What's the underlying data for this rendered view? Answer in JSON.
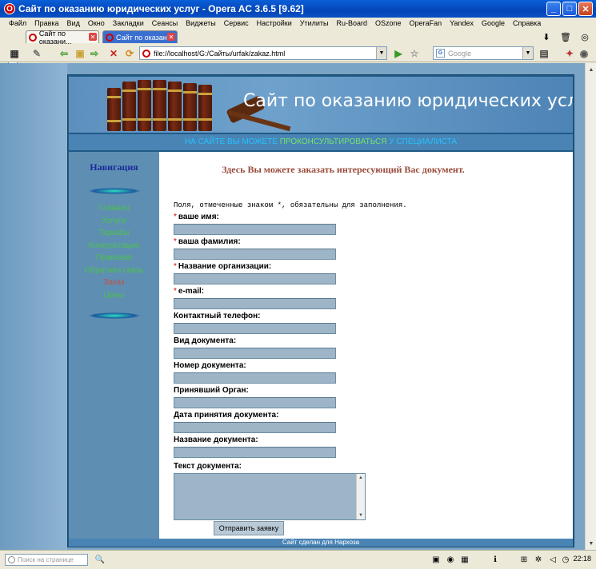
{
  "window": {
    "title": "Сайт по оказанию юридических услуг - Opera AC 3.6.5 [9.62]",
    "controls": [
      "_",
      "□",
      "✕"
    ]
  },
  "menu": [
    "Файл",
    "Правка",
    "Вид",
    "Окно",
    "Закладки",
    "Сеансы",
    "Виджеты",
    "Сервис",
    "Настройки",
    "Утилиты",
    "Ru-Board",
    "OSzone",
    "OperaFan",
    "Yandex",
    "Google",
    "Справка"
  ],
  "tabs": [
    {
      "label": "Сайт по оказани..."
    },
    {
      "label": "Сайт по оказан..."
    }
  ],
  "address": {
    "url": "file://localhost/G:/Сайты/urfak/zakaz.html"
  },
  "search": {
    "engine_initial": "G",
    "placeholder": "Google"
  },
  "site": {
    "banner_title": "Сайт по оказанию юридических услуг",
    "slogan_start": "НА САЙТЕ ВЫ МОЖЕТЕ ",
    "slogan_highlight": "ПРОКОНСУЛЬТИРОВАТЬСЯ",
    "slogan_end": " У СПЕЦИАЛИСТА",
    "sidebar": {
      "heading": "Навигация",
      "links": [
        {
          "label": "Главная",
          "active": false
        },
        {
          "label": "Услуги",
          "active": false
        },
        {
          "label": "Тарифы",
          "active": false
        },
        {
          "label": "Консультации",
          "active": false
        },
        {
          "label": "Правовая",
          "active": false
        },
        {
          "label": "Обратная связь",
          "active": false
        },
        {
          "label": "Заказ",
          "active": true
        },
        {
          "label": "Цены",
          "active": false
        }
      ]
    },
    "content": {
      "heading": "Здесь Вы можете заказать интересующий Вас документ.",
      "note": "Поля, отмеченные знаком *, обязательны для заполнения.",
      "fields": [
        {
          "label": "ваше имя:",
          "required": true,
          "value": ""
        },
        {
          "label": "ваша фамилия:",
          "required": true,
          "value": ""
        },
        {
          "label": "Название организации:",
          "required": true,
          "value": ""
        },
        {
          "label": "e-mail:",
          "required": true,
          "value": ""
        },
        {
          "label": "Контактный телефон:",
          "required": false,
          "value": ""
        },
        {
          "label": "Вид документа:",
          "required": false,
          "value": ""
        },
        {
          "label": "Номер документа:",
          "required": false,
          "value": ""
        },
        {
          "label": "Принявший Орган:",
          "required": false,
          "value": ""
        },
        {
          "label": "Дата принятия документа:",
          "required": false,
          "value": ""
        },
        {
          "label": "Название документа:",
          "required": false,
          "value": ""
        }
      ],
      "textarea_label": "Текст документа:",
      "textarea_value": "",
      "submit_label": "Отправить заявку"
    },
    "footer": "Сайт сделан для Нархоза"
  },
  "statusbar": {
    "find_placeholder": "Поиск на странице",
    "clock": "22:18"
  },
  "colors": {
    "titlebar": "#0446b8",
    "page_bg": "#7aa4c6",
    "nav_link": "#4cc04c",
    "nav_active": "#c0504a",
    "heading": "#9a4a3a",
    "input_bg": "#9db5c6"
  }
}
